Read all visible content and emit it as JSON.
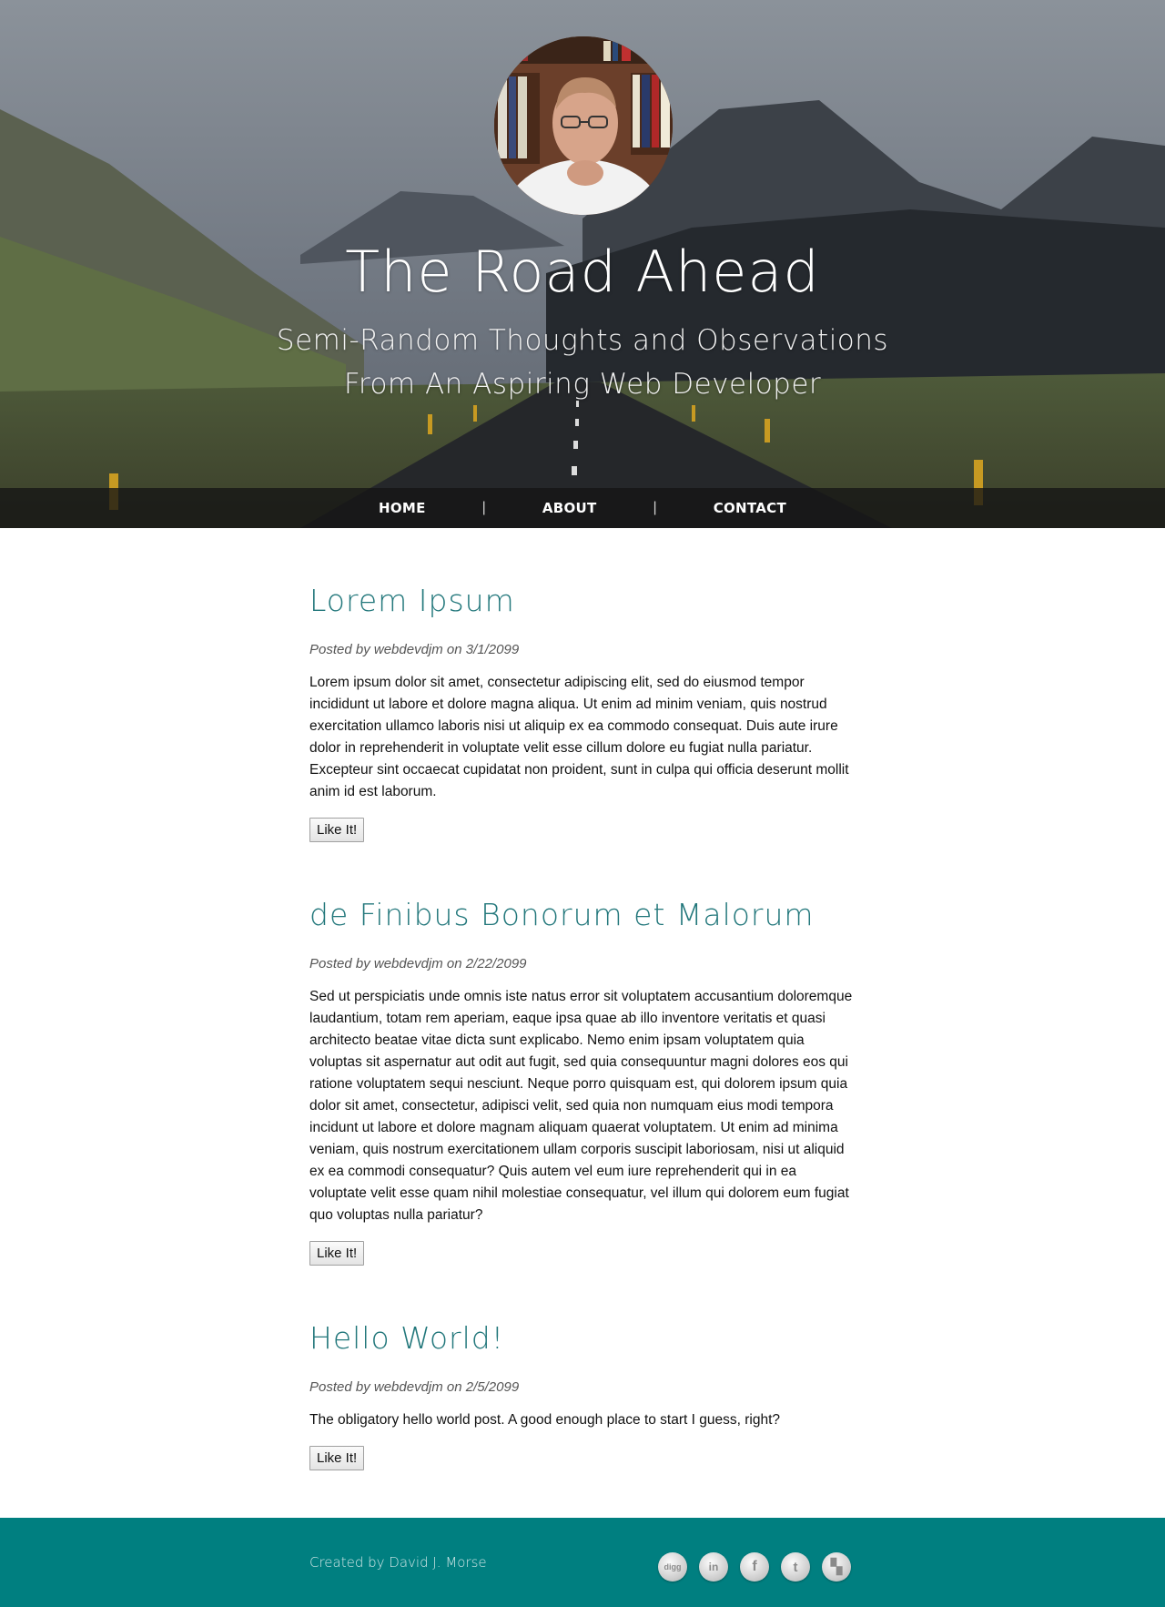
{
  "header": {
    "title": "The Road Ahead",
    "subtitle_line1": "Semi-Random Thoughts and Observations",
    "subtitle_line2": "From An Aspiring Web Developer",
    "avatar_icon": "author-portrait"
  },
  "nav": {
    "items": [
      {
        "label": "HOME"
      },
      {
        "label": "ABOUT"
      },
      {
        "label": "CONTACT"
      }
    ],
    "separator": "|"
  },
  "posts": [
    {
      "title": "Lorem Ipsum",
      "meta": "Posted by webdevdjm on 3/1/2099",
      "body": "Lorem ipsum dolor sit amet, consectetur adipiscing elit, sed do eiusmod tempor incididunt ut labore et dolore magna aliqua. Ut enim ad minim veniam, quis nostrud exercitation ullamco laboris nisi ut aliquip ex ea commodo consequat. Duis aute irure dolor in reprehenderit in voluptate velit esse cillum dolore eu fugiat nulla pariatur. Excepteur sint occaecat cupidatat non proident, sunt in culpa qui officia deserunt mollit anim id est laborum.",
      "like_label": "Like It!"
    },
    {
      "title": "de Finibus Bonorum et Malorum",
      "meta": "Posted by webdevdjm on 2/22/2099",
      "body": "Sed ut perspiciatis unde omnis iste natus error sit voluptatem accusantium doloremque laudantium, totam rem aperiam, eaque ipsa quae ab illo inventore veritatis et quasi architecto beatae vitae dicta sunt explicabo. Nemo enim ipsam voluptatem quia voluptas sit aspernatur aut odit aut fugit, sed quia consequuntur magni dolores eos qui ratione voluptatem sequi nesciunt. Neque porro quisquam est, qui dolorem ipsum quia dolor sit amet, consectetur, adipisci velit, sed quia non numquam eius modi tempora incidunt ut labore et dolore magnam aliquam quaerat voluptatem. Ut enim ad minima veniam, quis nostrum exercitationem ullam corporis suscipit laboriosam, nisi ut aliquid ex ea commodi consequatur? Quis autem vel eum iure reprehenderit qui in ea voluptate velit esse quam nihil molestiae consequatur, vel illum qui dolorem eum fugiat quo voluptas nulla pariatur?",
      "like_label": "Like It!"
    },
    {
      "title": "Hello World!",
      "meta": "Posted by webdevdjm on 2/5/2099",
      "body": "The obligatory hello world post. A good enough place to start I guess, right?",
      "like_label": "Like It!"
    }
  ],
  "footer": {
    "credit": "Created by David J. Morse",
    "social": [
      {
        "icon": "digg-icon",
        "glyph": "digg"
      },
      {
        "icon": "linkedin-icon",
        "glyph": "in"
      },
      {
        "icon": "facebook-icon",
        "glyph": "f"
      },
      {
        "icon": "twitter-icon",
        "glyph": "t"
      },
      {
        "icon": "delicious-icon",
        "glyph": "▚"
      }
    ]
  },
  "colors": {
    "accent": "#22777b",
    "footer_bg": "#007f80"
  }
}
